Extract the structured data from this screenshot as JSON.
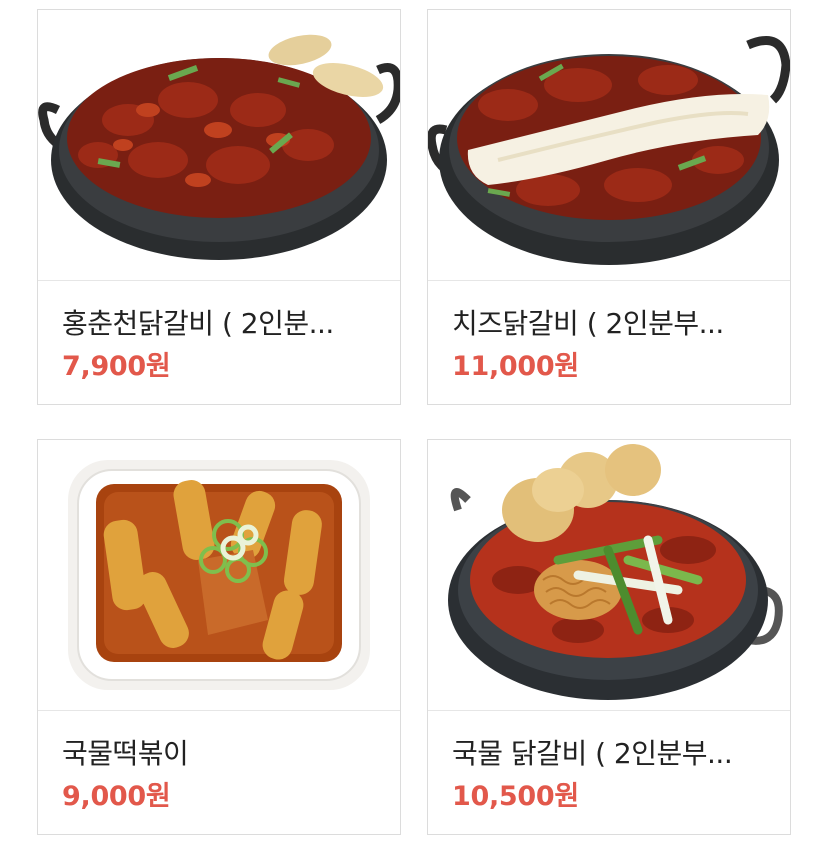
{
  "menu": {
    "items": [
      {
        "name": "홍춘천닭갈비 ( 2인분...",
        "price": "7,900원",
        "image": "spicy-chicken-galbi-pan"
      },
      {
        "name": "치즈닭갈비 ( 2인분부...",
        "price": "11,000원",
        "image": "cheese-chicken-galbi-pan"
      },
      {
        "name": "국물떡볶이",
        "price": "9,000원",
        "image": "soup-tteokbokki-dish"
      },
      {
        "name": "국물 닭갈비 ( 2인분부...",
        "price": "10,500원",
        "image": "soup-chicken-galbi-pot"
      }
    ]
  },
  "colors": {
    "price": "#e2584b",
    "name": "#222222",
    "border": "#dcdcdc"
  }
}
